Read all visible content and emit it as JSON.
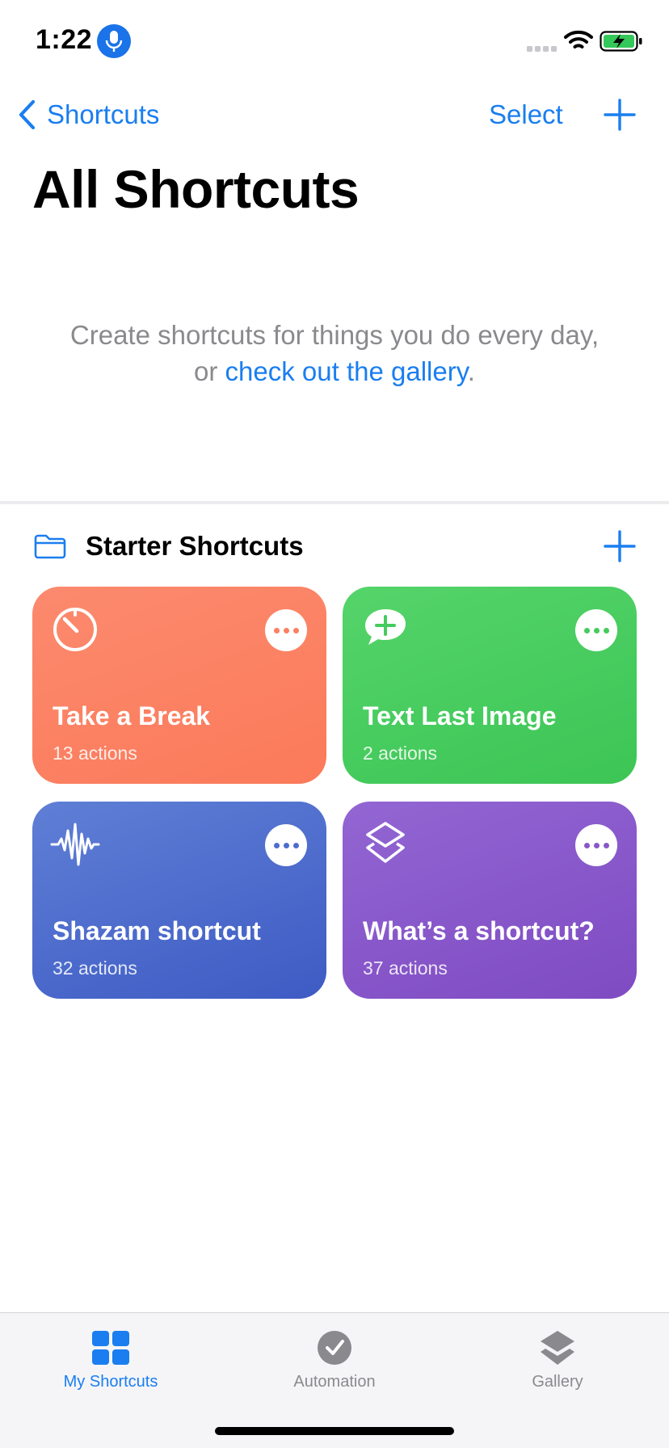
{
  "status_bar": {
    "time": "1:22",
    "mic_icon": "microphone-icon",
    "signal_icon": "cellular-signal-icon",
    "wifi_icon": "wifi-icon",
    "battery_icon": "battery-charging-icon"
  },
  "nav": {
    "back_label": "Shortcuts",
    "select_label": "Select",
    "add_icon": "plus-icon"
  },
  "page_title": "All Shortcuts",
  "empty_state": {
    "line1": "Create shortcuts for things you do every day,",
    "prefix": "or ",
    "link": "check out the gallery",
    "suffix": "."
  },
  "folder": {
    "title": "Starter Shortcuts",
    "icon": "folder-icon",
    "add_icon": "plus-icon"
  },
  "shortcuts": [
    {
      "name": "Take a Break",
      "count": "13 actions",
      "icon": "timer-icon",
      "color": "#fb7f62"
    },
    {
      "name": "Text Last Image",
      "count": "2 actions",
      "icon": "message-plus-icon",
      "color": "#46cb5d"
    },
    {
      "name": "Shazam shortcut",
      "count": "32 actions",
      "icon": "waveform-icon",
      "color": "#4d6dcd"
    },
    {
      "name": "What’s a shortcut?",
      "count": "37 actions",
      "icon": "shortcuts-layers-icon",
      "color": "#8858ca"
    }
  ],
  "tabs": [
    {
      "label": "My Shortcuts",
      "icon": "grid-icon",
      "active": true
    },
    {
      "label": "Automation",
      "icon": "checkmark-clock-icon",
      "active": false
    },
    {
      "label": "Gallery",
      "icon": "layers-icon",
      "active": false
    }
  ],
  "colors": {
    "accent": "#1a7ef0",
    "secondary_text": "#8a8a8e"
  }
}
